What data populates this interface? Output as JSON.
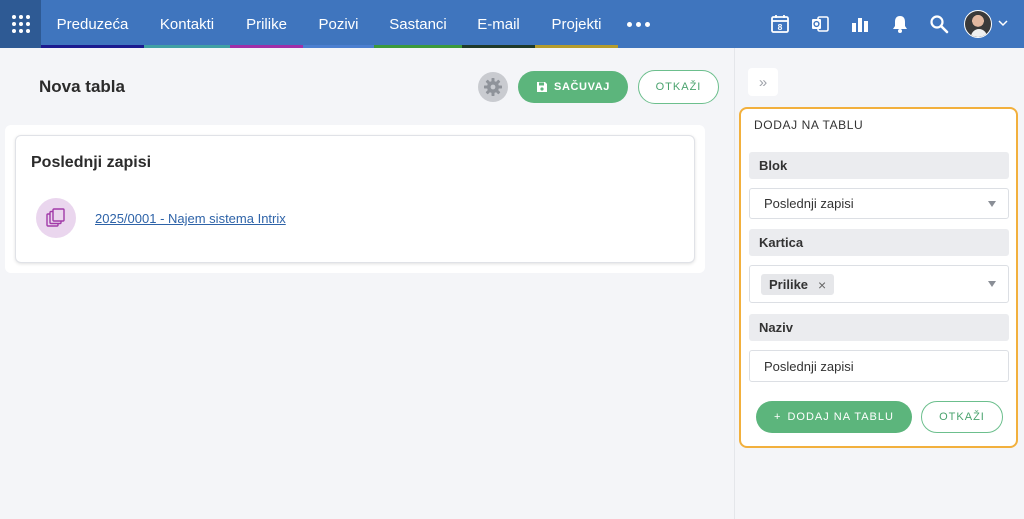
{
  "nav": {
    "items": [
      {
        "label": "Preduzeća",
        "color": "#1b1b8f"
      },
      {
        "label": "Kontakti",
        "color": "#41a0a4"
      },
      {
        "label": "Prilike",
        "color": "#a12fa8"
      },
      {
        "label": "Pozivi",
        "color": "#4b7fd0"
      },
      {
        "label": "Sastanci",
        "color": "#3c9a3c"
      },
      {
        "label": "E-mail",
        "color": "#1f3a2a"
      },
      {
        "label": "Projekti",
        "color": "#b59c2c"
      }
    ],
    "calendar_day": "8",
    "icons": [
      "apps-grid-icon",
      "more-icon",
      "calendar-icon",
      "outlook-icon",
      "reports-icon",
      "bell-icon",
      "search-icon",
      "avatar",
      "chevron-down-icon"
    ]
  },
  "toolbar": {
    "title": "Nova tabla",
    "save_label": "SAČUVAJ",
    "cancel_label": "OTKAŽI"
  },
  "widget": {
    "title": "Poslednji zapisi",
    "records": [
      {
        "label": "2025/0001 - Najem sistema Intrix"
      }
    ]
  },
  "panel": {
    "title": "DODAJ NA TABLU",
    "block_label": "Blok",
    "block_value": "Poslednji zapisi",
    "card_label": "Kartica",
    "card_tag": "Prilike",
    "name_label": "Naziv",
    "name_value": "Poslednji zapisi",
    "add_label": "DODAJ NA TABLU",
    "cancel_label": "OTKAŽI"
  },
  "colors": {
    "nav_bg": "#3f75be",
    "accent_green": "#5cb57c",
    "panel_border": "#f2b03d",
    "link": "#2e63a8"
  }
}
